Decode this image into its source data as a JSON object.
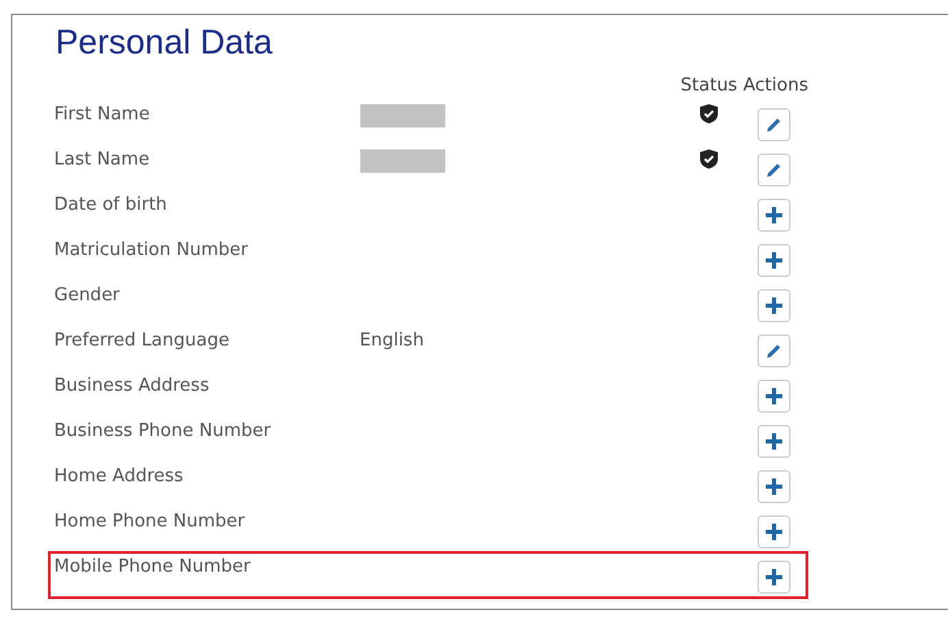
{
  "title": "Personal Data",
  "columns": {
    "status": "Status",
    "actions": "Actions"
  },
  "rows": [
    {
      "label": "First Name",
      "redacted": true,
      "verified": true,
      "kind": "edit",
      "highlighted": false
    },
    {
      "label": "Last Name",
      "redacted": true,
      "verified": true,
      "kind": "edit",
      "highlighted": false
    },
    {
      "label": "Date of birth",
      "verified": false,
      "kind": "add",
      "highlighted": false
    },
    {
      "label": "Matriculation Number",
      "verified": false,
      "kind": "add",
      "highlighted": false
    },
    {
      "label": "Gender",
      "verified": false,
      "kind": "add",
      "highlighted": false
    },
    {
      "label": "Preferred Language",
      "value": "English",
      "verified": false,
      "kind": "edit",
      "highlighted": false
    },
    {
      "label": "Business Address",
      "verified": false,
      "kind": "add",
      "highlighted": false
    },
    {
      "label": "Business Phone Number",
      "verified": false,
      "kind": "add",
      "highlighted": false
    },
    {
      "label": "Home Address",
      "verified": false,
      "kind": "add",
      "highlighted": false
    },
    {
      "label": "Home Phone Number",
      "verified": false,
      "kind": "add",
      "highlighted": false
    },
    {
      "label": "Mobile Phone Number",
      "verified": false,
      "kind": "add",
      "highlighted": true
    }
  ]
}
